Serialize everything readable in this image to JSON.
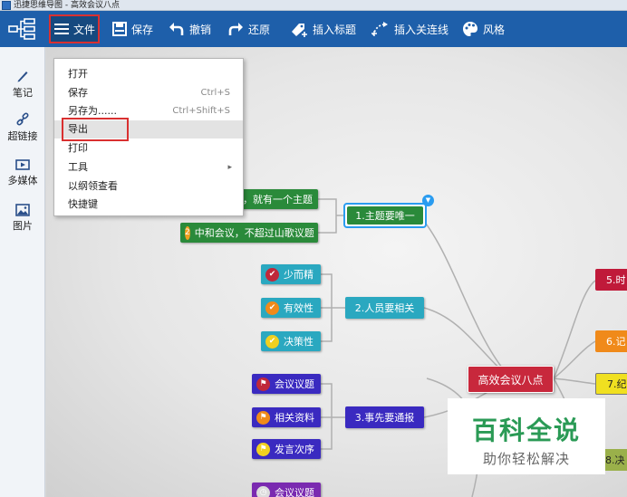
{
  "window": {
    "title": "迅捷思维导图 - 高效会议八点"
  },
  "toolbar": {
    "file": "文件",
    "save": "保存",
    "undo": "撤销",
    "redo": "还原",
    "insert_topic": "插入标题",
    "insert_link_line": "插入关连线",
    "style": "风格"
  },
  "sidebar": {
    "items": [
      {
        "label": "笔记"
      },
      {
        "label": "超链接"
      },
      {
        "label": "多媒体"
      },
      {
        "label": "图片"
      }
    ]
  },
  "file_menu": {
    "items": [
      {
        "label": "打开",
        "shortcut": ""
      },
      {
        "label": "保存",
        "shortcut": "Ctrl+S"
      },
      {
        "label": "另存为......",
        "shortcut": "Ctrl+Shift+S"
      },
      {
        "label": "导出",
        "shortcut": ""
      },
      {
        "label": "打印",
        "shortcut": ""
      },
      {
        "label": "工具",
        "shortcut": "",
        "submenu_arrow": "▸"
      },
      {
        "label": "以纲领查看",
        "shortcut": ""
      },
      {
        "label": "快捷键",
        "shortcut": ""
      }
    ]
  },
  "mindmap": {
    "central": "高效会议八点",
    "topics": {
      "t1": "1.主题要唯一",
      "t2": "2.人员要相关",
      "t3": "3.事先要通报",
      "t5": "5.时",
      "t6": "6.记",
      "t7": "7.纪",
      "t8": "8.决"
    },
    "subtopics": {
      "s1a_text": "议，就有一个主题",
      "s1b_num": "2",
      "s1b_text": "中和会议，不超过山歌议题",
      "s2a": "少而精",
      "s2b": "有效性",
      "s2c": "决策性",
      "s3a": "会议议题",
      "s3b": "相关资料",
      "s3c": "发言次序",
      "s4a": "会议议题"
    },
    "colors": {
      "central": "#c8283c",
      "t1": "#2a8a3a",
      "t2": "#2aa8c0",
      "t3": "#3a2ac0"
    }
  },
  "watermark": {
    "title": "百科全说",
    "subtitle": "助你轻松解决"
  }
}
